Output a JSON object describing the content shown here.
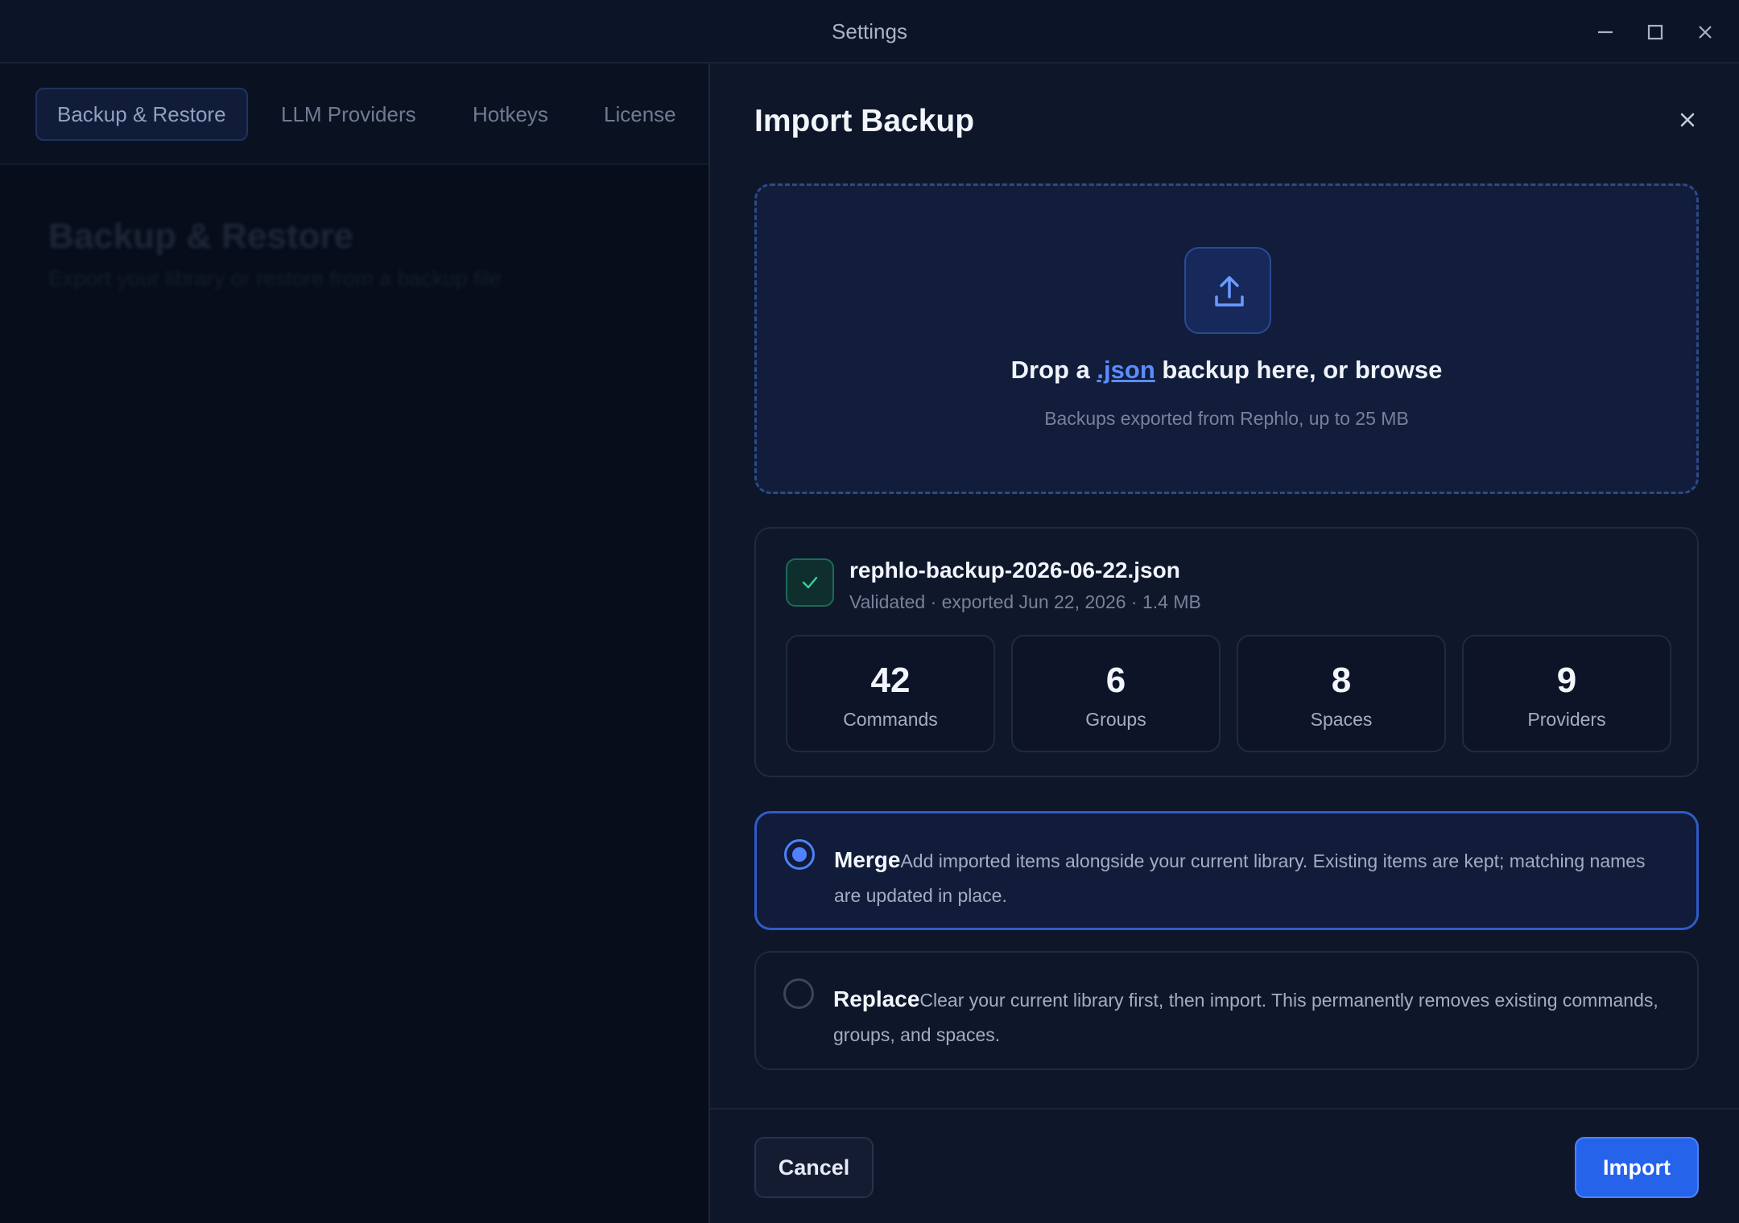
{
  "window": {
    "title": "Settings",
    "controls": [
      "minimize-icon",
      "maximize-icon",
      "close-icon"
    ]
  },
  "tabs": [
    {
      "label": "Backup & Restore",
      "active": true
    },
    {
      "label": "LLM Providers",
      "active": false
    },
    {
      "label": "Hotkeys",
      "active": false
    },
    {
      "label": "License",
      "active": false
    }
  ],
  "section": {
    "title": "Backup & Restore",
    "subtitle": "Export your library or restore from a backup file"
  },
  "drawer": {
    "title": "Import Backup",
    "dropzone": {
      "icon": "upload-icon",
      "text_prefix": "Drop a ",
      "text_link": ".json",
      "text_suffix": " backup here, or browse",
      "hint": "Backups exported from Rephlo, up to 25 MB"
    },
    "file": {
      "name": "rephlo-backup-2026-06-22.json",
      "meta": "Validated · exported Jun 22, 2026 · 1.4 MB",
      "stats": [
        {
          "value": "42",
          "label": "Commands"
        },
        {
          "value": "6",
          "label": "Groups"
        },
        {
          "value": "8",
          "label": "Spaces"
        },
        {
          "value": "9",
          "label": "Providers"
        }
      ]
    },
    "options": [
      {
        "title": "Merge",
        "description": "Add imported items alongside your current library. Existing items are kept; matching names are updated in place.",
        "selected": true
      },
      {
        "title": "Replace",
        "description": "Clear your current library first, then import. This permanently removes existing commands, groups, and spaces.",
        "selected": false
      }
    ],
    "cancel_label": "Cancel",
    "import_label": "Import"
  },
  "colors": {
    "accent": "#2563eb",
    "success": "#34d399",
    "background": "#0b1221"
  }
}
